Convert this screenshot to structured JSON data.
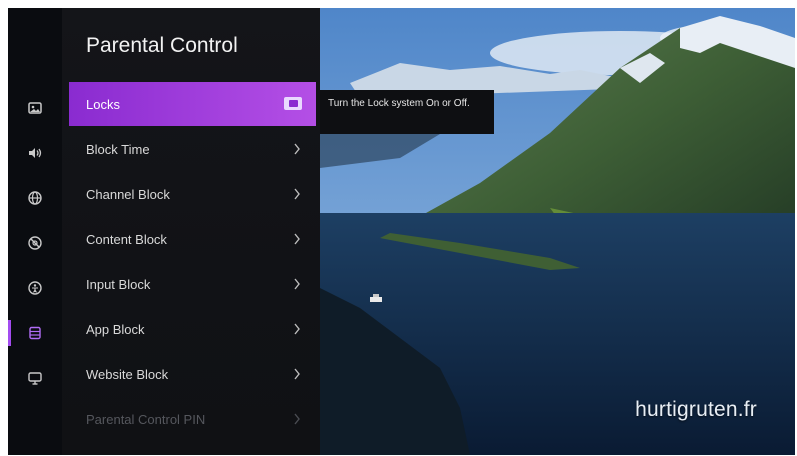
{
  "panel": {
    "title": "Parental Control",
    "items": [
      {
        "label": "Locks",
        "control": "toggle",
        "state": "on"
      },
      {
        "label": "Block Time",
        "control": "chevron"
      },
      {
        "label": "Channel Block",
        "control": "chevron"
      },
      {
        "label": "Content Block",
        "control": "chevron"
      },
      {
        "label": "Input Block",
        "control": "chevron"
      },
      {
        "label": "App Block",
        "control": "chevron"
      },
      {
        "label": "Website Block",
        "control": "chevron"
      },
      {
        "label": "Parental Control PIN",
        "control": "chevron",
        "state": "disabled"
      }
    ]
  },
  "tooltip": {
    "text": "Turn the Lock system On or Off."
  },
  "rail": {
    "icons": [
      "picture-icon",
      "sound-icon",
      "network-icon",
      "accessibility-icon",
      "general-icon",
      "system-icon",
      "support-icon"
    ],
    "active_index": 5
  },
  "background": {
    "watermark": "hurtigruten.fr"
  },
  "colors": {
    "accent": "#a34cf0",
    "selected_gradient_start": "#8a2bd0",
    "selected_gradient_end": "#b44fe6",
    "panel_bg": "#121318"
  }
}
